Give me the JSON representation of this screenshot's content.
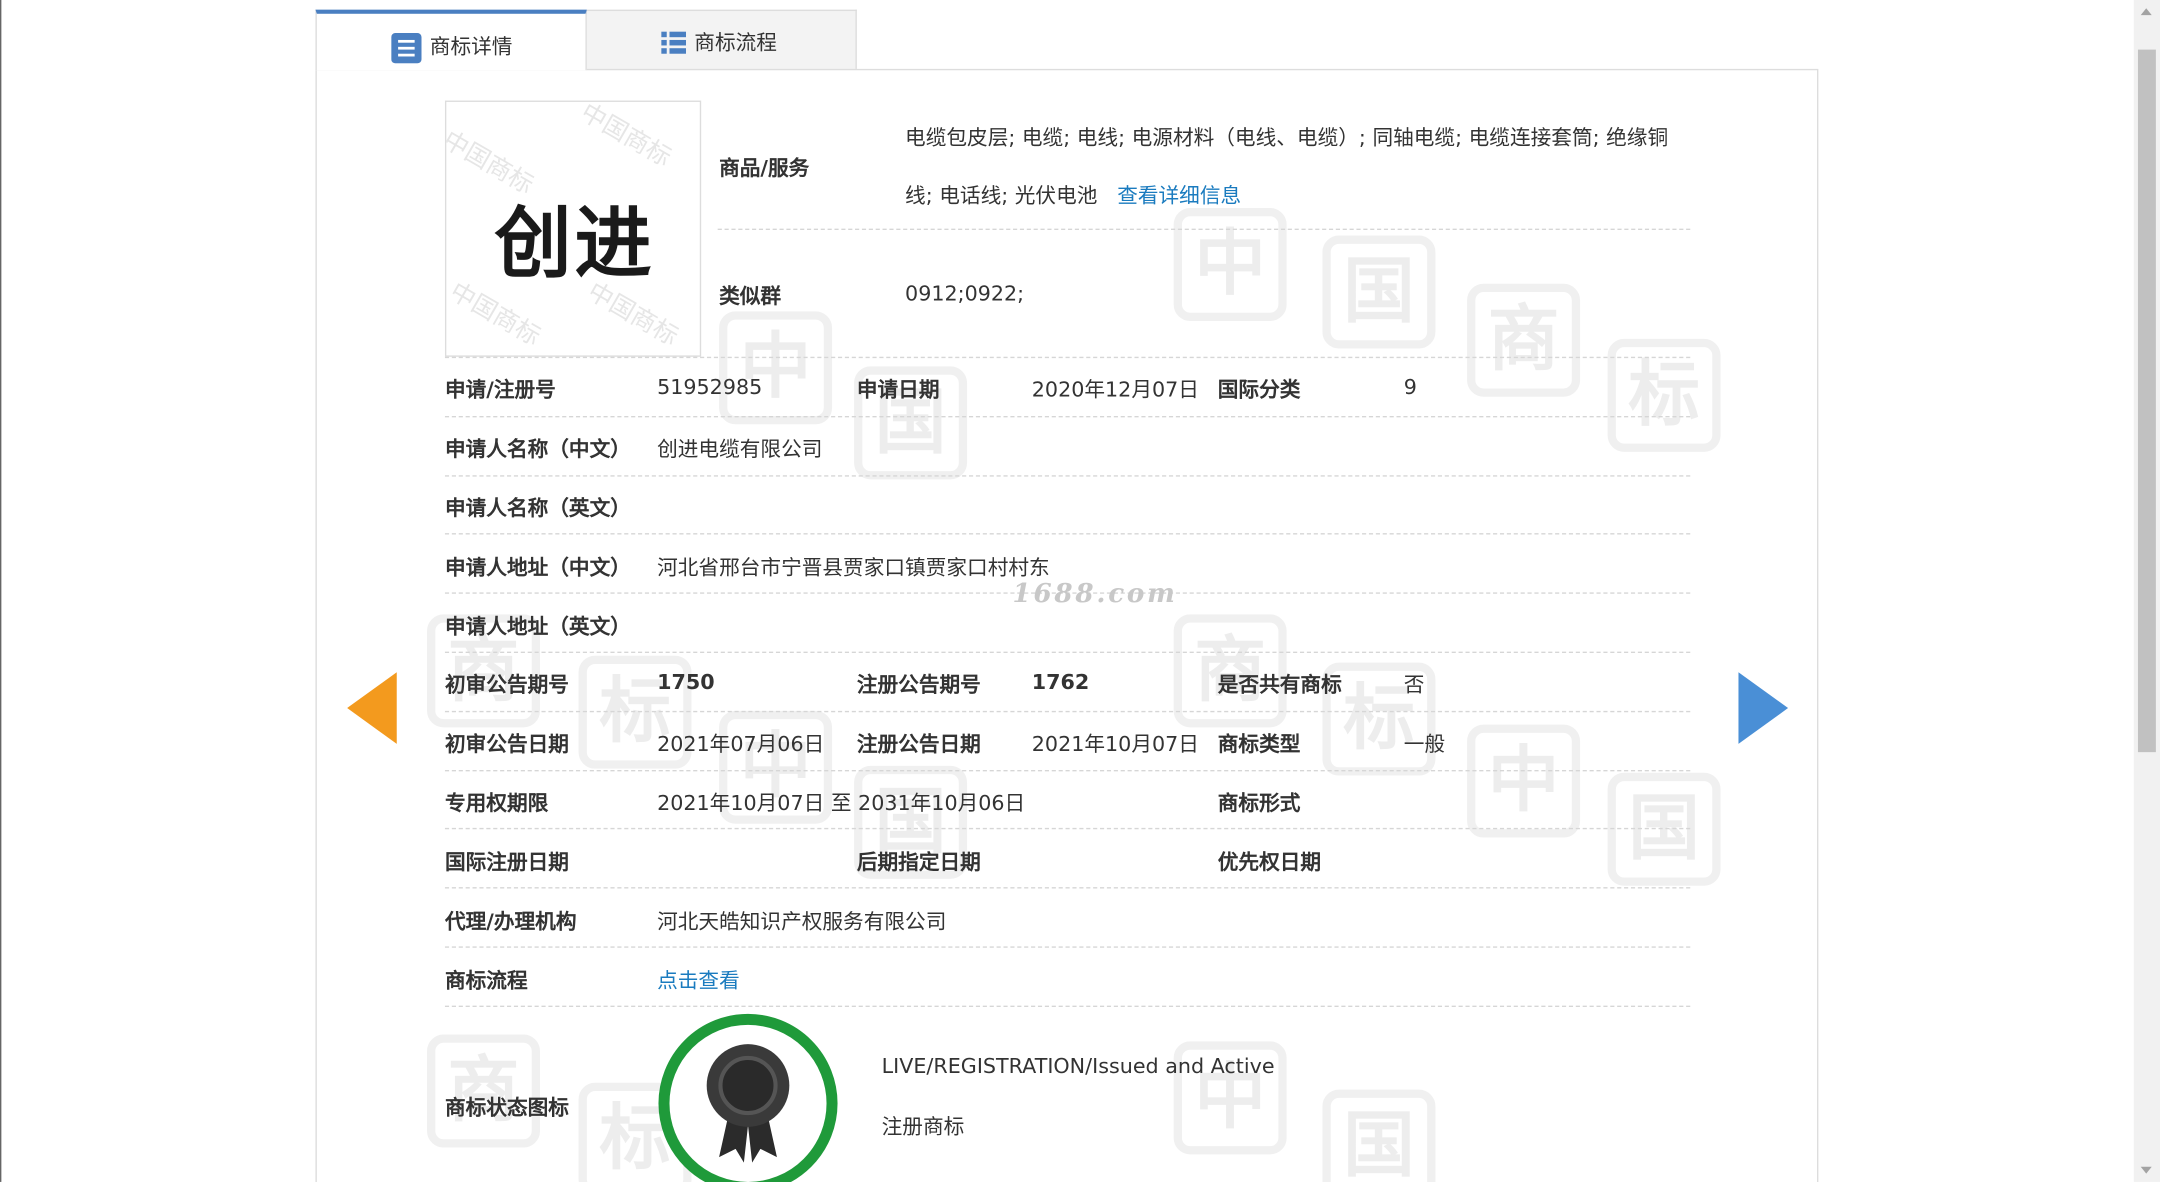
{
  "tabs": {
    "detail": "商标详情",
    "flow": "商标流程"
  },
  "logo": {
    "text": "创进",
    "watermark": "中国商标"
  },
  "goods": {
    "label": "商品/服务",
    "line1": "电缆包皮层; 电缆; 电线; 电源材料（电线、电缆）; 同轴电缆; 电缆连接套筒; 绝缘铜",
    "line2": "线; 电话线; 光伏电池",
    "link": "查看详细信息"
  },
  "similar": {
    "label": "类似群",
    "value": "0912;0922;"
  },
  "reg_no": {
    "label": "申请/注册号",
    "value": "51952985"
  },
  "app_date": {
    "label": "申请日期",
    "value": "2020年12月07日"
  },
  "intl_class": {
    "label": "国际分类",
    "value": "9"
  },
  "applicant_cn": {
    "label": "申请人名称（中文）",
    "value": "创进电缆有限公司"
  },
  "applicant_en": {
    "label": "申请人名称（英文）",
    "value": ""
  },
  "address_cn": {
    "label": "申请人地址（中文）",
    "value": "河北省邢台市宁晋县贾家口镇贾家口村村东"
  },
  "address_en": {
    "label": "申请人地址（英文）",
    "value": ""
  },
  "prelim_issue": {
    "label": "初审公告期号",
    "value": "1750"
  },
  "reg_issue": {
    "label": "注册公告期号",
    "value": "1762"
  },
  "shared": {
    "label": "是否共有商标",
    "value": "否"
  },
  "prelim_date": {
    "label": "初审公告日期",
    "value": "2021年07月06日"
  },
  "reg_date": {
    "label": "注册公告日期",
    "value": "2021年10月07日"
  },
  "tm_type": {
    "label": "商标类型",
    "value": "一般"
  },
  "exclusive": {
    "label": "专用权期限",
    "value": "2021年10月07日 至 2031年10月06日"
  },
  "tm_form": {
    "label": "商标形式",
    "value": ""
  },
  "intl_reg_date": {
    "label": "国际注册日期",
    "value": ""
  },
  "later_date": {
    "label": "后期指定日期",
    "value": ""
  },
  "priority_date": {
    "label": "优先权日期",
    "value": ""
  },
  "agent": {
    "label": "代理/办理机构",
    "value": "河北天皓知识产权服务有限公司"
  },
  "process": {
    "label": "商标流程",
    "link": "点击查看"
  },
  "status": {
    "label": "商标状态图标",
    "en": "LIVE/REGISTRATION/Issued and Active",
    "cn": "注册商标"
  },
  "site_watermark": "1688.com",
  "watermark_chars": [
    "中",
    "国",
    "商",
    "标"
  ],
  "colors": {
    "tab_accent": "#4a7fc1",
    "link": "#1a7bbf",
    "prev_arrow": "#f39a1e",
    "next_arrow": "#4a8fd6",
    "badge": "#1f9a3a"
  }
}
